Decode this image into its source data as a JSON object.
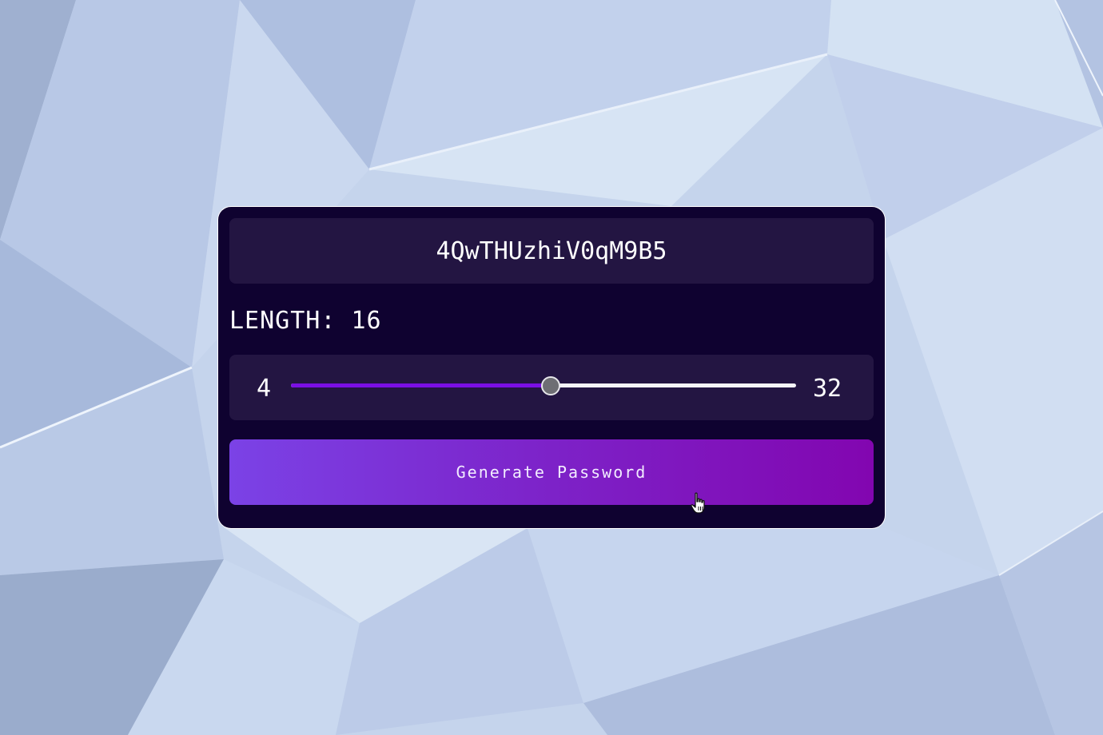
{
  "colors": {
    "card_background": "#0f0230",
    "panel_background": "#231542",
    "slider_fill": "#7a0fe4",
    "button_gradient_start": "#7b42e6",
    "button_gradient_end": "#8206b0",
    "text": "#ffffff"
  },
  "password": {
    "value": "4QwTHUzhiV0qM9B5"
  },
  "length": {
    "label": "LENGTH:",
    "value": "16"
  },
  "slider": {
    "min": 4,
    "max": 32,
    "value": 16,
    "fill_fraction": 0.515
  },
  "generate_button": {
    "label": "Generate Password"
  },
  "icons": {
    "cursor": "hand-pointer-icon",
    "slider_thumb": "slider-thumb"
  }
}
